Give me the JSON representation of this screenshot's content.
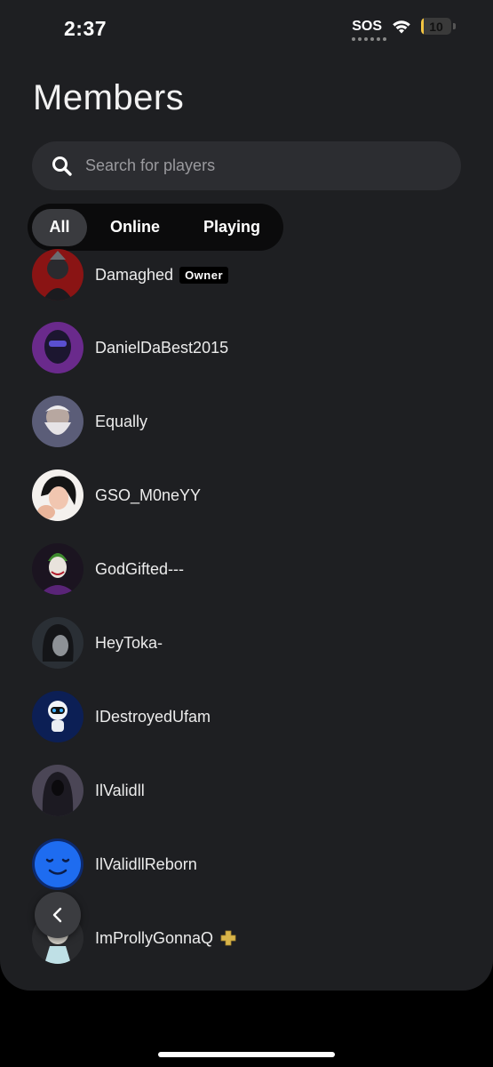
{
  "status_bar": {
    "time": "2:37",
    "sos": "SOS",
    "battery_level": "10",
    "battery_fraction": 0.1,
    "battery_color": "#f4c542"
  },
  "page": {
    "title": "Members"
  },
  "search": {
    "placeholder": "Search for players"
  },
  "filters": {
    "tabs": [
      "All",
      "Online",
      "Playing"
    ],
    "active": "All"
  },
  "members": [
    {
      "name": "Damaghed",
      "badge": "Owner",
      "avatar": "dark-masked-figure-avatar"
    },
    {
      "name": "DanielDaBest2015",
      "avatar": "purple-helmet-avatar"
    },
    {
      "name": "Equally",
      "avatar": "bearded-elder-avatar"
    },
    {
      "name": "GSO_M0neYY",
      "avatar": "anime-girl-avatar"
    },
    {
      "name": "GodGifted---",
      "avatar": "joker-avatar"
    },
    {
      "name": "HeyToka-",
      "avatar": "dark-hair-figure-avatar"
    },
    {
      "name": "IDestroyedUfam",
      "avatar": "robot-avatar"
    },
    {
      "name": "IlValidll",
      "avatar": "hooded-reaper-avatar"
    },
    {
      "name": "IlValidllReborn",
      "avatar": "blue-smiley-avatar"
    },
    {
      "name": "ImProllyGonnaQ",
      "avatar": "cartoon-scientist-avatar",
      "plus": true
    }
  ],
  "colors": {
    "background": "#1e1f22",
    "search_bg": "#2c2d31",
    "filter_bar_bg": "#0b0b0c",
    "active_tab_bg": "#3a3b3f",
    "ps_plus": "#d9b54a"
  }
}
